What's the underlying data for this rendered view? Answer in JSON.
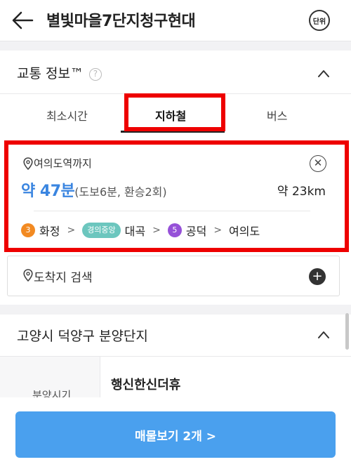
{
  "header": {
    "back_icon": "arrow-left-icon",
    "title": "별빛마을7단지청구현대",
    "unit_label": "단위"
  },
  "transport": {
    "title": "교통 정보™",
    "help_icon": "question-circle-icon",
    "help_glyph": "?",
    "collapse_icon": "chevron-up-icon",
    "tabs": [
      {
        "label": "최소시간",
        "active": false
      },
      {
        "label": "지하철",
        "active": true
      },
      {
        "label": "버스",
        "active": false
      }
    ],
    "route": {
      "destination": "여의도역까지",
      "close_glyph": "✕",
      "time_main": "약 47분",
      "time_detail": "(도보6분, 환승2회)",
      "distance": "약 23km",
      "stations": [
        {
          "line": "3",
          "line_color": "#f28a22",
          "name": "화정"
        },
        {
          "line": "경의중앙",
          "line_color": "#6cc6be",
          "name": "대곡"
        },
        {
          "line": "5",
          "line_color": "#9651d8",
          "name": "공덕"
        },
        {
          "name": "여의도"
        }
      ],
      "arrow_glyph": ">"
    },
    "search": {
      "label": "도착지 검색",
      "add_glyph": "+"
    }
  },
  "complex": {
    "title": "고양시 덕양구 분양단지",
    "collapse_icon": "chevron-up-icon",
    "row_key": "분양시기",
    "row_value": "행신한신더휴"
  },
  "cta": {
    "label": "매물보기 2개 >"
  },
  "colors": {
    "accent_blue": "#3a85e0",
    "cta_blue": "#4aa0ee",
    "highlight_red": "#ee0000"
  }
}
